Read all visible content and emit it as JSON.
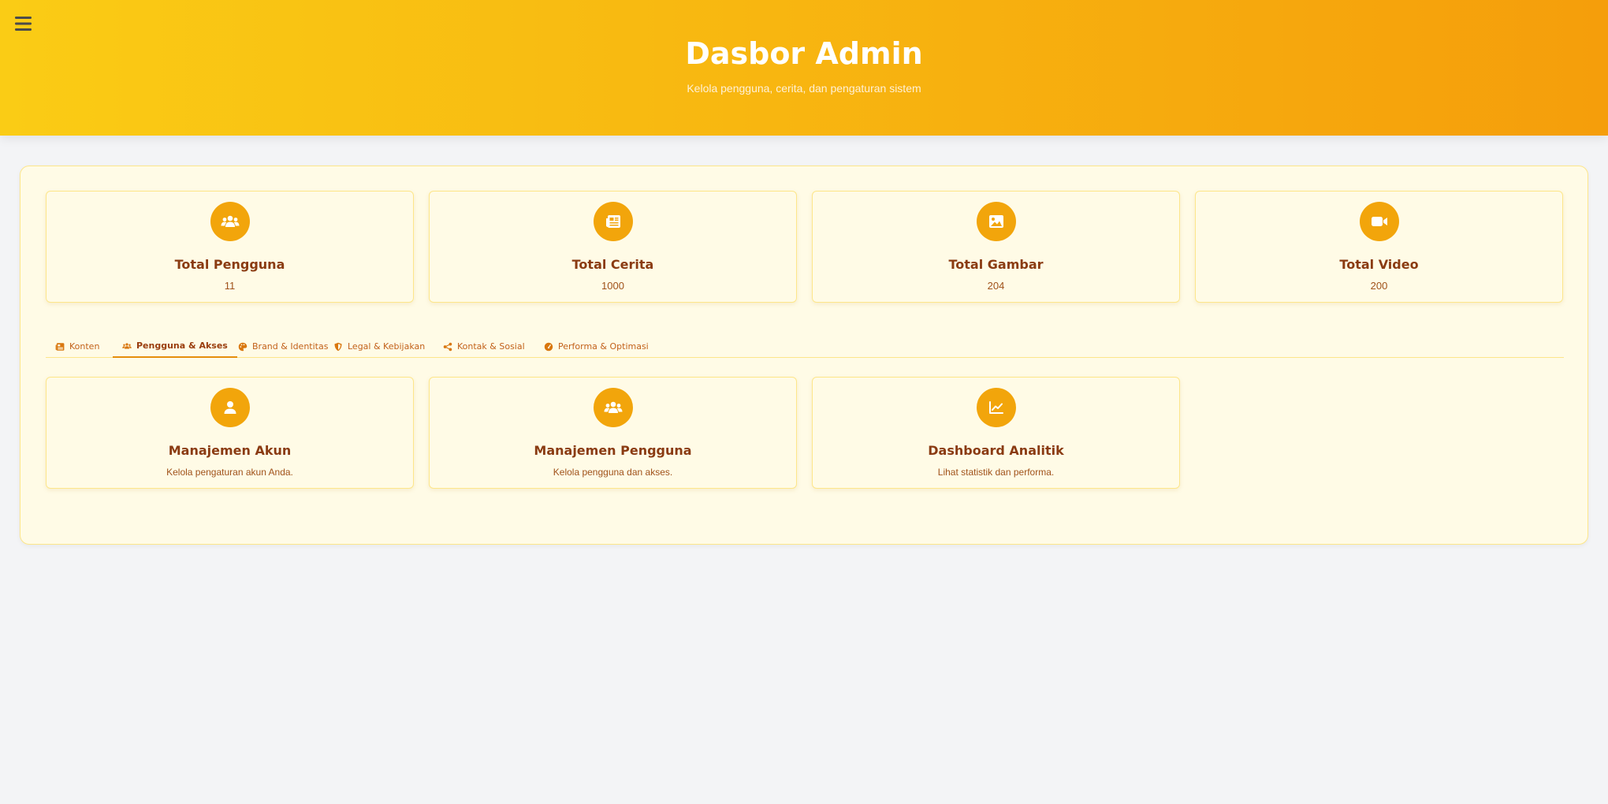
{
  "header": {
    "title": "Dasbor Admin",
    "subtitle": "Kelola pengguna, cerita, dan pengaturan sistem",
    "menu_icon": "hamburger-menu-icon"
  },
  "stats": [
    {
      "title": "Total Pengguna",
      "value": "11",
      "icon": "users-icon"
    },
    {
      "title": "Total Cerita",
      "value": "1000",
      "icon": "newspaper-icon"
    },
    {
      "title": "Total Gambar",
      "value": "204",
      "icon": "image-icon"
    },
    {
      "title": "Total Video",
      "value": "200",
      "icon": "video-icon"
    }
  ],
  "tabs": [
    {
      "label": "Konten",
      "icon": "newspaper-icon",
      "active": false
    },
    {
      "label": "Pengguna & Akses",
      "icon": "users-icon",
      "active": true
    },
    {
      "label": "Brand & Identitas",
      "icon": "palette-icon",
      "active": false
    },
    {
      "label": "Legal & Kebijakan",
      "icon": "shield-icon",
      "active": false
    },
    {
      "label": "Kontak & Sosial",
      "icon": "share-icon",
      "active": false
    },
    {
      "label": "Performa & Optimasi",
      "icon": "gauge-icon",
      "active": false
    }
  ],
  "features": [
    {
      "title": "Manajemen Akun",
      "desc": "Kelola pengaturan akun Anda.",
      "icon": "user-icon"
    },
    {
      "title": "Manajemen Pengguna",
      "desc": "Kelola pengguna dan akses.",
      "icon": "users-icon"
    },
    {
      "title": "Dashboard Analitik",
      "desc": "Lihat statistik dan performa.",
      "icon": "chart-line-icon"
    }
  ],
  "colors": {
    "header_start": "#facc15",
    "header_end": "#f59e0b",
    "accent": "#f2a50b",
    "title_text": "#8a3b12",
    "panel_bg": "#fffbe6"
  }
}
